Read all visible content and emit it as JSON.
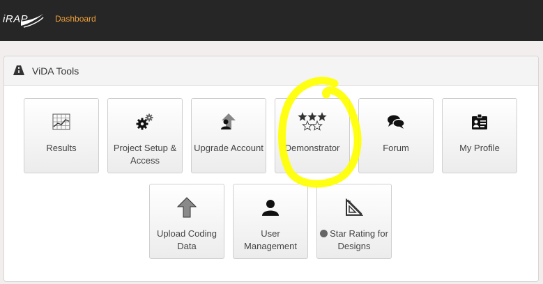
{
  "navbar": {
    "logo_text": "iRAP",
    "dashboard_link": "Dashboard"
  },
  "panel": {
    "title": "ViDA Tools",
    "title_icon": "road-icon"
  },
  "tiles": [
    {
      "label": "Results",
      "icon": "grid-chart-icon"
    },
    {
      "label": "Project Setup & Access",
      "icon": "gears-icon"
    },
    {
      "label": "Upgrade Account",
      "icon": "user-upgrade-icon"
    },
    {
      "label": "Demonstrator",
      "icon": "stars-icon"
    },
    {
      "label": "Forum",
      "icon": "chat-bubbles-icon"
    },
    {
      "label": "My Profile",
      "icon": "id-card-icon"
    },
    {
      "label": "Upload Coding Data",
      "icon": "upload-arrow-icon"
    },
    {
      "label": "User Management",
      "icon": "user-icon"
    },
    {
      "label": "Star Rating for Designs",
      "icon": "drafting-triangle-icon",
      "prefix_icon": "globe-icon"
    }
  ],
  "colors": {
    "navbar_bg": "#262626",
    "nav_link": "#f0a038",
    "annotation": "#ffff00"
  }
}
